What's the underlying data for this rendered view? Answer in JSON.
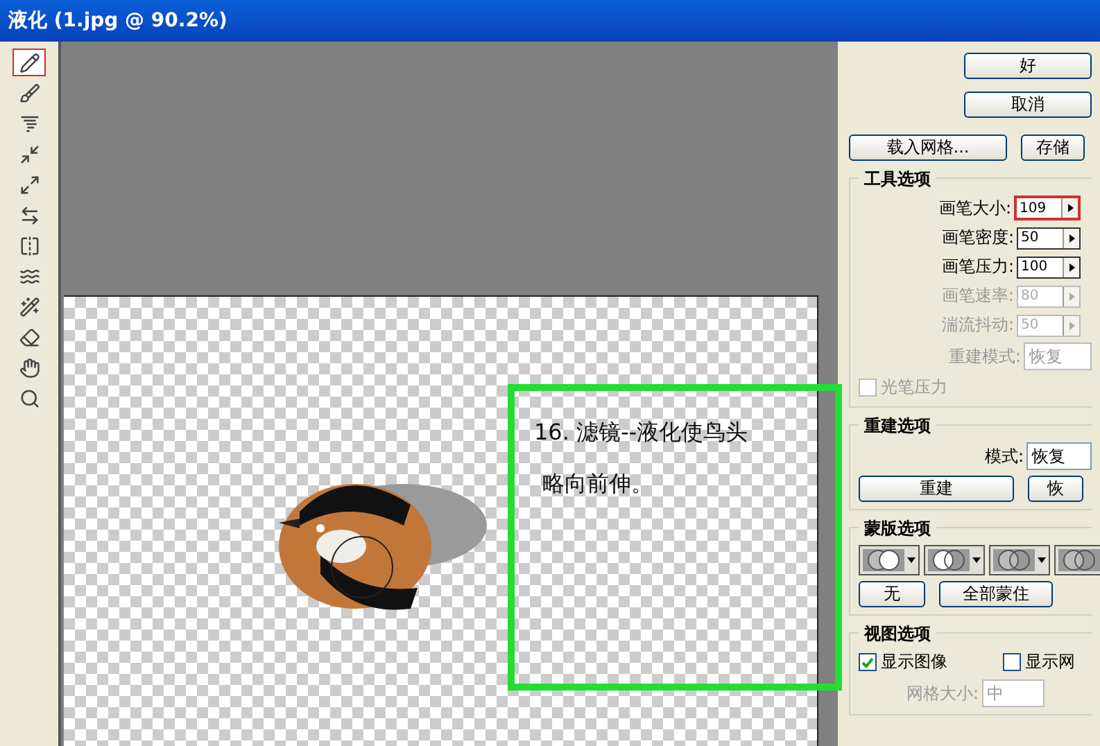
{
  "window": {
    "title": "液化 (1.jpg @ 90.2%)"
  },
  "tools": [
    {
      "kind": "warp",
      "selected": true
    },
    {
      "kind": "reconstruct",
      "selected": false
    },
    {
      "kind": "twirl",
      "selected": false
    },
    {
      "kind": "pucker",
      "selected": false
    },
    {
      "kind": "bloat",
      "selected": false
    },
    {
      "kind": "push",
      "selected": false
    },
    {
      "kind": "mirror",
      "selected": false
    },
    {
      "kind": "turbulence",
      "selected": false
    },
    {
      "kind": "freeze",
      "selected": false
    },
    {
      "kind": "thaw",
      "selected": false
    },
    {
      "kind": "hand",
      "selected": false
    },
    {
      "kind": "zoom",
      "selected": false
    }
  ],
  "canvas": {
    "note_lines": [
      "16. 滤镜--液化使鸟头",
      "略向前伸。"
    ]
  },
  "top_buttons": [
    "好",
    "取消"
  ],
  "mesh_buttons": [
    "载入网格...",
    "存储"
  ],
  "tool_options": {
    "title": "工具选项",
    "fields": [
      {
        "label": "画笔大小:",
        "value": "109",
        "disabled": false,
        "highlighted": true
      },
      {
        "label": "画笔密度:",
        "value": "50",
        "disabled": false,
        "highlighted": false
      },
      {
        "label": "画笔压力:",
        "value": "100",
        "disabled": false,
        "highlighted": false
      },
      {
        "label": "画笔速率:",
        "value": "80",
        "disabled": true,
        "highlighted": false
      },
      {
        "label": "湍流抖动:",
        "value": "50",
        "disabled": true,
        "highlighted": false
      }
    ],
    "mode": {
      "label": "重建模式:",
      "value": "恢复",
      "disabled": true
    },
    "stylus": {
      "label": "光笔压力",
      "checked": false,
      "disabled": true
    }
  },
  "reconstruct_options": {
    "title": "重建选项",
    "mode_label": "模式:",
    "mode_value": "恢复",
    "buttons": [
      "重建",
      "恢"
    ]
  },
  "mask_options": {
    "title": "蒙版选项",
    "modes": [
      {
        "selected": false
      },
      {
        "selected": false
      },
      {
        "selected": false
      },
      {
        "selected": false
      }
    ],
    "buttons": [
      "无",
      "全部蒙住"
    ]
  },
  "view_options": {
    "title": "视图选项",
    "checkboxes": [
      {
        "label": "显示图像",
        "checked": true
      },
      {
        "label": "显示网",
        "checked": false
      }
    ],
    "grid_size": {
      "label": "网格大小:",
      "value": "中",
      "disabled": true
    }
  }
}
